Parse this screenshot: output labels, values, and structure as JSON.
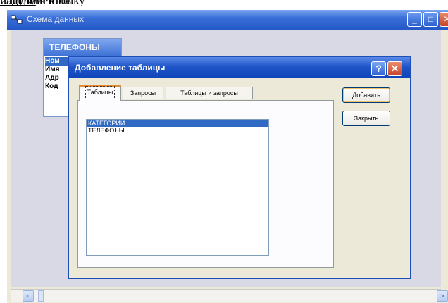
{
  "document": {
    "text_before": "…ду  или кнопку",
    "text_underlined": "  панели",
    "text_after": " инструментов."
  },
  "main_window": {
    "title": "Схема данных",
    "min_glyph": "_",
    "max_glyph": "□",
    "close_glyph": "✕"
  },
  "table_window": {
    "title": "ТЕЛЕФОНЫ",
    "fields": [
      "Ном",
      "Имя",
      "Адр",
      "Код"
    ]
  },
  "dialog": {
    "title": "Добавление таблицы",
    "help_glyph": "?",
    "close_glyph": "✕",
    "tabs": [
      "Таблицы",
      "Запросы",
      "Таблицы и запросы"
    ],
    "active_tab": 0,
    "list_items": [
      "КАТЕГОРИИ",
      "ТЕЛЕФОНЫ"
    ],
    "selected_item": 0,
    "buttons": {
      "add": "Добавить",
      "close": "Закрыть"
    }
  },
  "scrollbar": {
    "left_glyph": "<",
    "right_glyph": ">"
  },
  "colors": {
    "titlebar_blue": "#2458c8",
    "selection": "#316ac5",
    "window_face": "#ece9d8",
    "close_red": "#c8432a"
  }
}
